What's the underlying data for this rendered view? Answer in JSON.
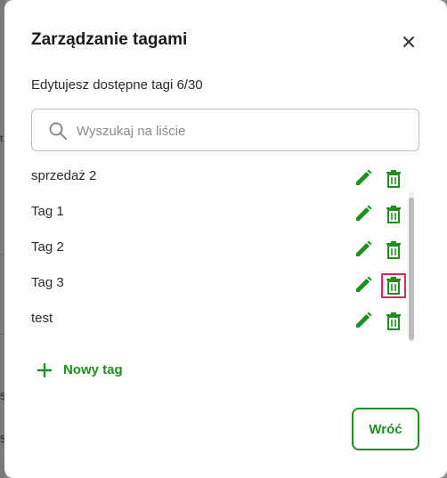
{
  "background": {
    "fragments": [
      "t",
      "5",
      "5"
    ]
  },
  "modal": {
    "title": "Zarządzanie tagami",
    "subtitle": "Edytujesz dostępne tagi 6/30",
    "search": {
      "placeholder": "Wyszukaj na liście",
      "value": ""
    },
    "tags": [
      {
        "label": "sprzedaż 2"
      },
      {
        "label": "Tag 1"
      },
      {
        "label": "Tag 2"
      },
      {
        "label": "Tag 3"
      },
      {
        "label": "test"
      }
    ],
    "new_tag_label": "Nowy tag",
    "back_label": "Wróć",
    "icons": {
      "close": "close-icon",
      "search": "search-icon",
      "edit": "pencil-icon",
      "delete": "trash-icon",
      "add": "plus-icon"
    },
    "colors": {
      "accent": "#1f8f1f",
      "highlight": "#e0245e"
    }
  }
}
